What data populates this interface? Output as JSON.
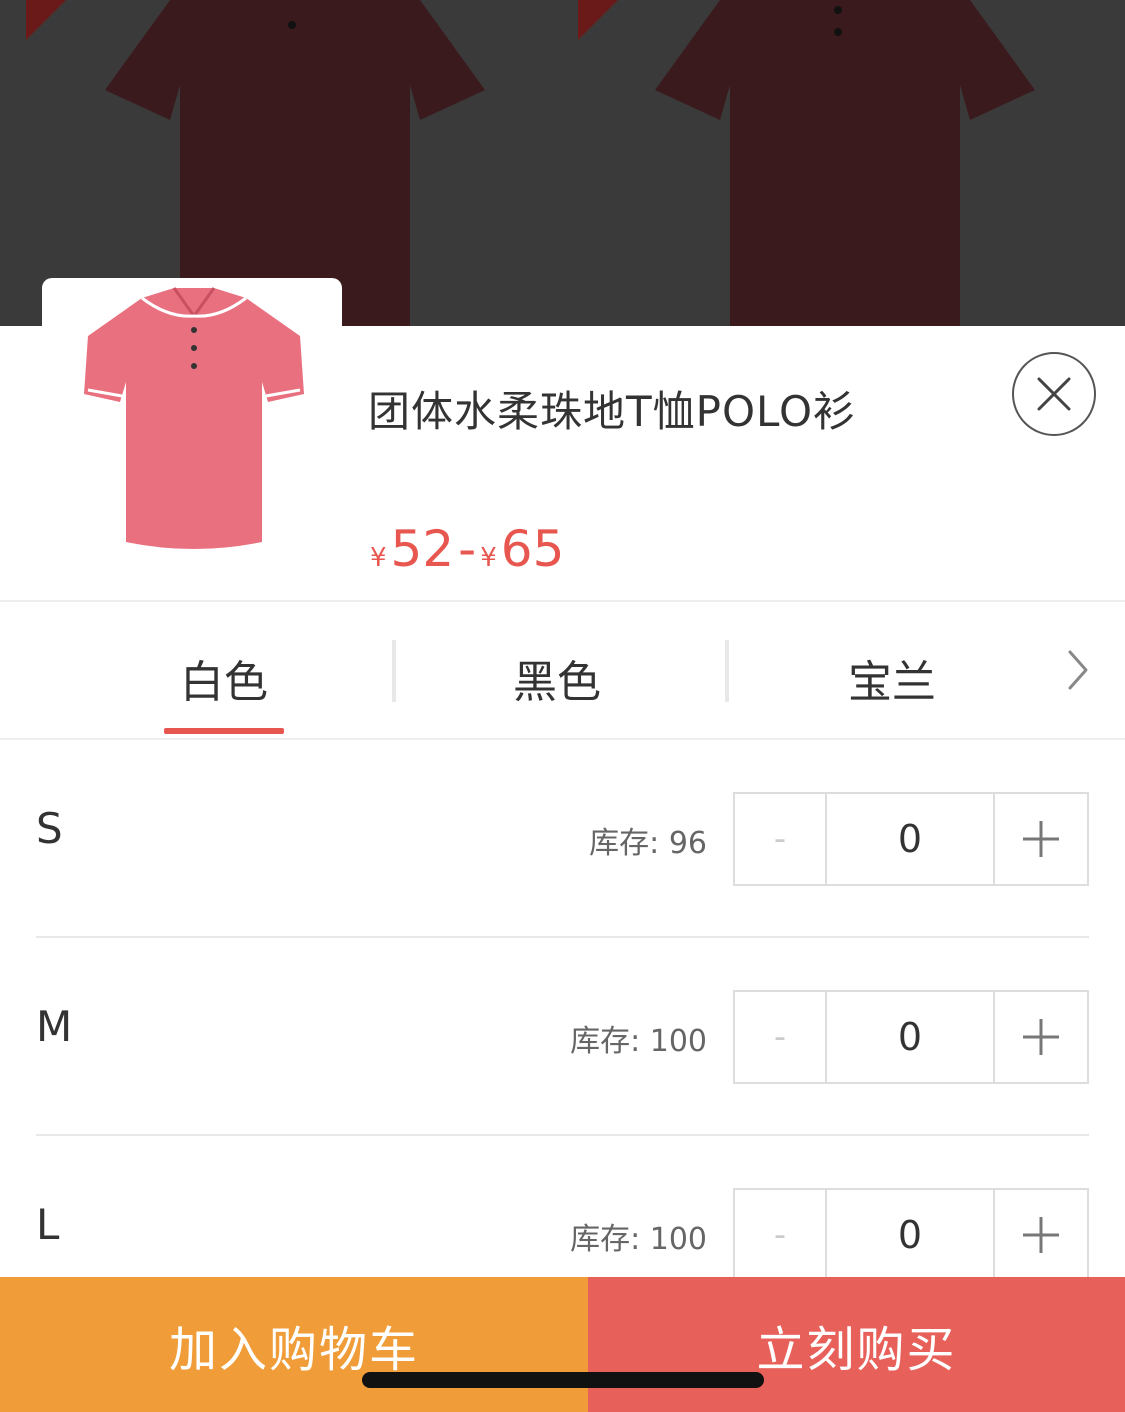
{
  "product": {
    "title": "团体水柔珠地T恤POLO衫",
    "price_min": "52",
    "price_max": "65",
    "currency_symbol": "¥",
    "price_separator": "-"
  },
  "colors": {
    "tabs": [
      {
        "label": "白色",
        "selected": true
      },
      {
        "label": "黑色",
        "selected": false
      },
      {
        "label": "宝兰",
        "selected": false
      }
    ],
    "accent": "#e8574f"
  },
  "sizes": [
    {
      "size": "S",
      "stock_text": "库存: 96",
      "quantity": "0",
      "minus": "-"
    },
    {
      "size": "M",
      "stock_text": "库存: 100",
      "quantity": "0",
      "minus": "-"
    },
    {
      "size": "L",
      "stock_text": "库存: 100",
      "quantity": "0",
      "minus": "-"
    }
  ],
  "actions": {
    "add_to_cart": "加入购物车",
    "buy_now": "立刻购买",
    "cart_color": "#f09c38",
    "buy_color": "#e8605a"
  },
  "icons": {
    "close": "close-icon",
    "next": "chevron-right-icon",
    "plus": "plus-icon"
  }
}
